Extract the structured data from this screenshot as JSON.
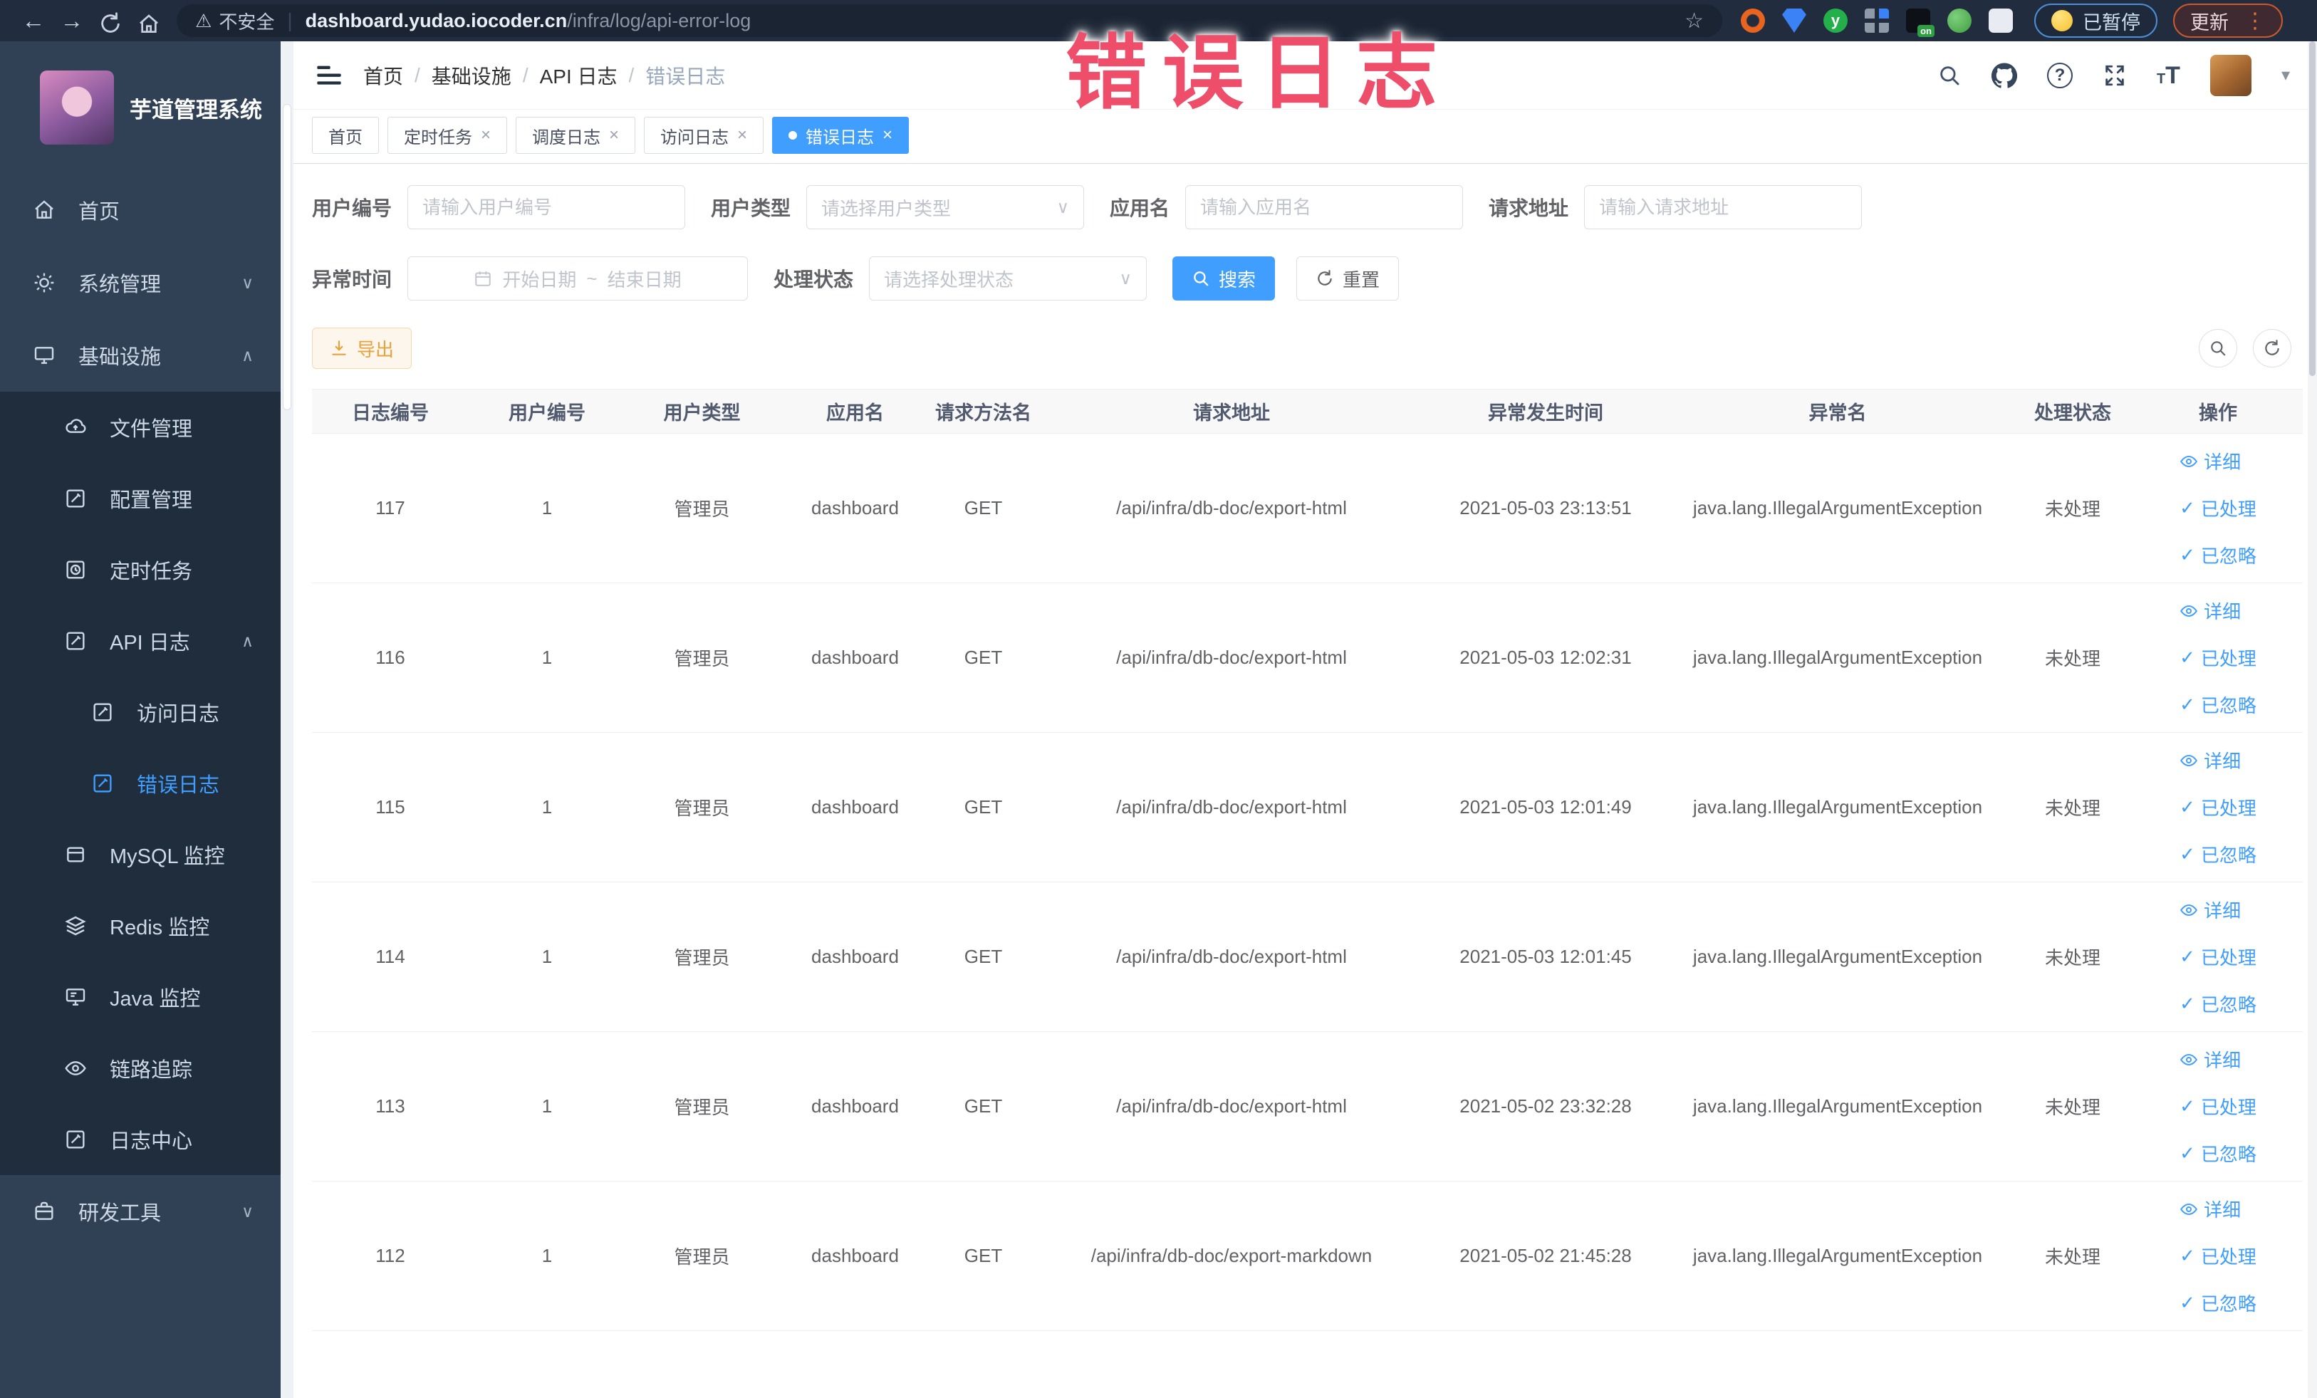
{
  "browser": {
    "security_label": "不安全",
    "url_host": "dashboard.yudao.iocoder.cn",
    "url_path": "/infra/log/api-error-log",
    "paused_label": "已暂停",
    "update_label": "更新"
  },
  "annotation": {
    "text": "错误日志",
    "color": "#ef4e6b"
  },
  "header": {
    "breadcrumb": [
      "首页",
      "基础设施",
      "API 日志",
      "错误日志"
    ]
  },
  "tabs": [
    {
      "label": "首页"
    },
    {
      "label": "定时任务"
    },
    {
      "label": "调度日志"
    },
    {
      "label": "访问日志"
    },
    {
      "label": "错误日志"
    }
  ],
  "sidebar": {
    "logo_title": "芋道管理系统",
    "menu": [
      {
        "label": "首页"
      },
      {
        "label": "系统管理"
      },
      {
        "label": "基础设施"
      },
      {
        "label": "文件管理"
      },
      {
        "label": "配置管理"
      },
      {
        "label": "定时任务"
      },
      {
        "label": "API 日志"
      },
      {
        "label": "访问日志"
      },
      {
        "label": "错误日志"
      },
      {
        "label": "MySQL 监控"
      },
      {
        "label": "Redis 监控"
      },
      {
        "label": "Java 监控"
      },
      {
        "label": "链路追踪"
      },
      {
        "label": "日志中心"
      },
      {
        "label": "研发工具"
      }
    ]
  },
  "filters": {
    "user_id": {
      "label": "用户编号",
      "placeholder": "请输入用户编号"
    },
    "user_type": {
      "label": "用户类型",
      "placeholder": "请选择用户类型"
    },
    "app_name": {
      "label": "应用名",
      "placeholder": "请输入应用名"
    },
    "request_url": {
      "label": "请求地址",
      "placeholder": "请输入请求地址"
    },
    "exception_time": {
      "label": "异常时间",
      "start_placeholder": "开始日期",
      "separator": "~",
      "end_placeholder": "结束日期"
    },
    "process_status": {
      "label": "处理状态",
      "placeholder": "请选择处理状态"
    },
    "search_label": "搜索",
    "reset_label": "重置"
  },
  "toolbar": {
    "export_label": "导出"
  },
  "table": {
    "columns": [
      "日志编号",
      "用户编号",
      "用户类型",
      "应用名",
      "请求方法名",
      "请求地址",
      "异常发生时间",
      "异常名",
      "处理状态",
      "操作"
    ],
    "actions": [
      "详细",
      "已处理",
      "已忽略"
    ],
    "rows": [
      {
        "id": "117",
        "user_id": "1",
        "user_type": "管理员",
        "app": "dashboard",
        "method": "GET",
        "url": "/api/infra/db-doc/export-html",
        "time": "2021-05-03 23:13:51",
        "exception": "java.lang.IllegalArgumentException",
        "status": "未处理"
      },
      {
        "id": "116",
        "user_id": "1",
        "user_type": "管理员",
        "app": "dashboard",
        "method": "GET",
        "url": "/api/infra/db-doc/export-html",
        "time": "2021-05-03 12:02:31",
        "exception": "java.lang.IllegalArgumentException",
        "status": "未处理"
      },
      {
        "id": "115",
        "user_id": "1",
        "user_type": "管理员",
        "app": "dashboard",
        "method": "GET",
        "url": "/api/infra/db-doc/export-html",
        "time": "2021-05-03 12:01:49",
        "exception": "java.lang.IllegalArgumentException",
        "status": "未处理"
      },
      {
        "id": "114",
        "user_id": "1",
        "user_type": "管理员",
        "app": "dashboard",
        "method": "GET",
        "url": "/api/infra/db-doc/export-html",
        "time": "2021-05-03 12:01:45",
        "exception": "java.lang.IllegalArgumentException",
        "status": "未处理"
      },
      {
        "id": "113",
        "user_id": "1",
        "user_type": "管理员",
        "app": "dashboard",
        "method": "GET",
        "url": "/api/infra/db-doc/export-html",
        "time": "2021-05-02 23:32:28",
        "exception": "java.lang.IllegalArgumentException",
        "status": "未处理"
      },
      {
        "id": "112",
        "user_id": "1",
        "user_type": "管理员",
        "app": "dashboard",
        "method": "GET",
        "url": "/api/infra/db-doc/export-markdown",
        "time": "2021-05-02 21:45:28",
        "exception": "java.lang.IllegalArgumentException",
        "status": "未处理"
      }
    ]
  },
  "icons": {
    "back": "←",
    "forward": "→",
    "star": "☆",
    "warning": "⚠",
    "divider": "|",
    "close": "×",
    "caret_down": "▾",
    "chevron_down": "∨",
    "chevron_up": "∧",
    "dots_v": "⋮",
    "check": "✓",
    "ext_badge": "on",
    "font_big": "T",
    "font_small": "T",
    "question": "?"
  },
  "colors": {
    "accent": "#409eff",
    "export": "#e6a23c",
    "sidebar": "#304156",
    "submenu": "#1f2d3d"
  }
}
